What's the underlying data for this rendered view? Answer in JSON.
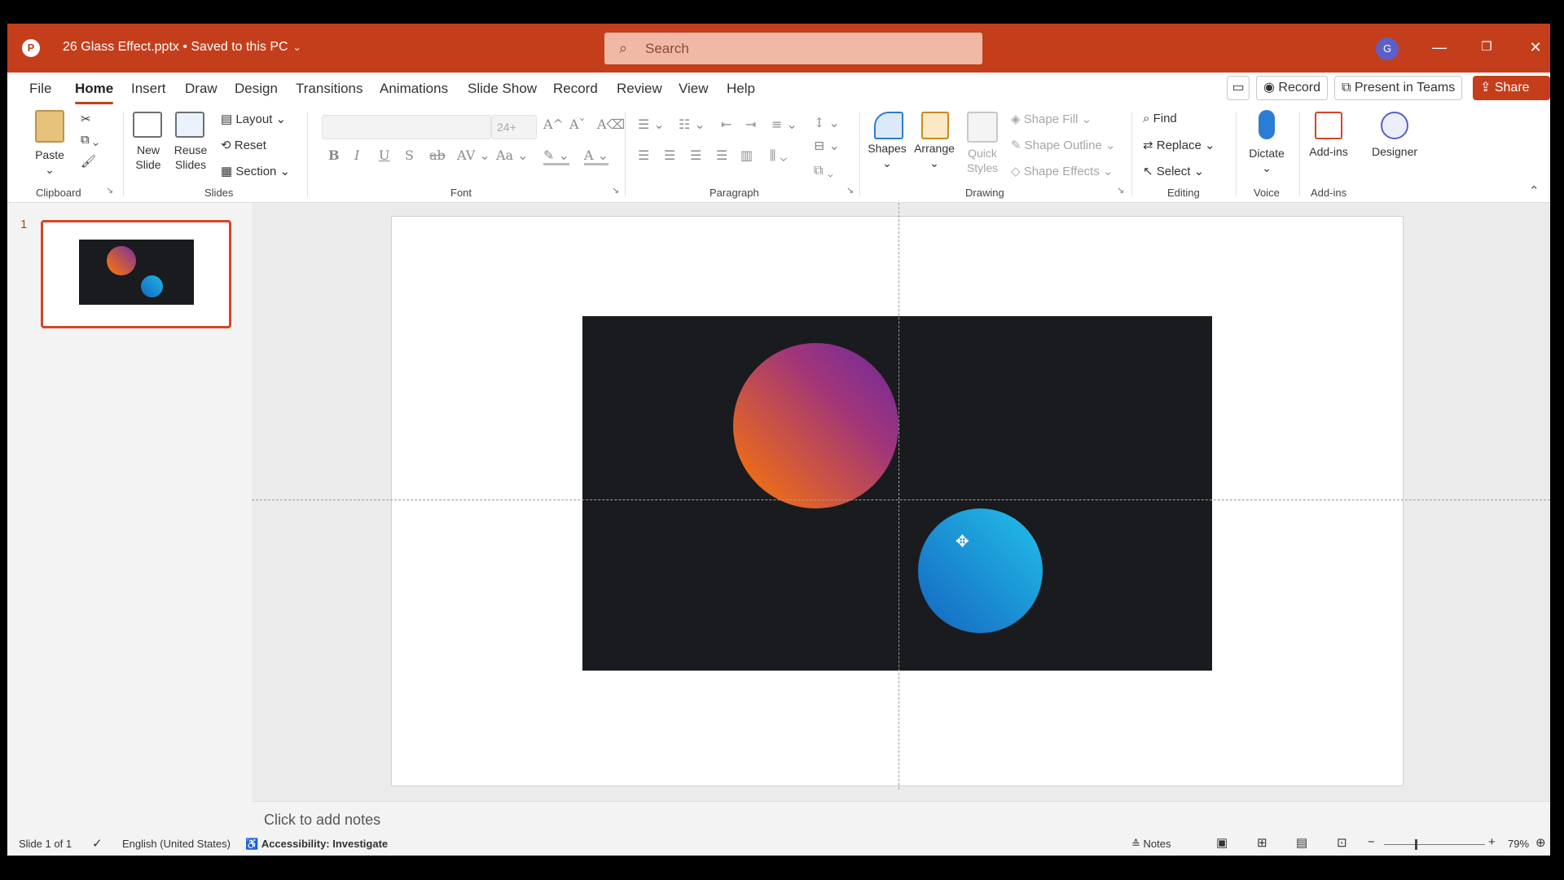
{
  "window": {
    "app_icon": "powerpoint-logo-icon",
    "document_title": "26 Glass Effect.pptx • Saved to this PC",
    "search_placeholder": "Search",
    "avatar_initial": "G",
    "accent_color": "#c43e1c"
  },
  "tabs": [
    "File",
    "Home",
    "Insert",
    "Draw",
    "Design",
    "Transitions",
    "Animations",
    "Slide Show",
    "Record",
    "Review",
    "View",
    "Help"
  ],
  "active_tab": "Home",
  "tab_actions": {
    "record": "Record",
    "present": "Present in Teams",
    "share": "Share"
  },
  "ribbon": {
    "clipboard": {
      "label": "Clipboard",
      "paste": "Paste"
    },
    "slides": {
      "label": "Slides",
      "new_slide": "New Slide",
      "reuse_slides": "Reuse Slides",
      "layout": "Layout",
      "reset": "Reset",
      "section": "Section"
    },
    "font": {
      "label": "Font",
      "size": "24+"
    },
    "paragraph": {
      "label": "Paragraph"
    },
    "drawing": {
      "label": "Drawing",
      "shapes": "Shapes",
      "arrange": "Arrange",
      "quick_styles": "Quick Styles",
      "shape_fill": "Shape Fill",
      "shape_outline": "Shape Outline",
      "shape_effects": "Shape Effects"
    },
    "editing": {
      "label": "Editing",
      "find": "Find",
      "replace": "Replace",
      "select": "Select"
    },
    "voice": {
      "label": "Voice",
      "dictate": "Dictate"
    },
    "addins": {
      "label": "Add-ins",
      "addins": "Add-ins",
      "designer": "Designer"
    }
  },
  "thumbnails": [
    {
      "number": "1"
    }
  ],
  "slide": {
    "background": "#1a1b1e",
    "shapes": [
      {
        "name": "orange-purple-circle",
        "gradient": [
          "#ff7a00",
          "#7b2fa0"
        ]
      },
      {
        "name": "blue-circle",
        "gradient": [
          "#1fb7e3",
          "#1565c0"
        ]
      }
    ]
  },
  "notes_placeholder": "Click to add notes",
  "status": {
    "slide_counter": "Slide 1 of 1",
    "language": "English (United States)",
    "accessibility": "Accessibility: Investigate",
    "notes": "Notes",
    "zoom": "79%"
  }
}
